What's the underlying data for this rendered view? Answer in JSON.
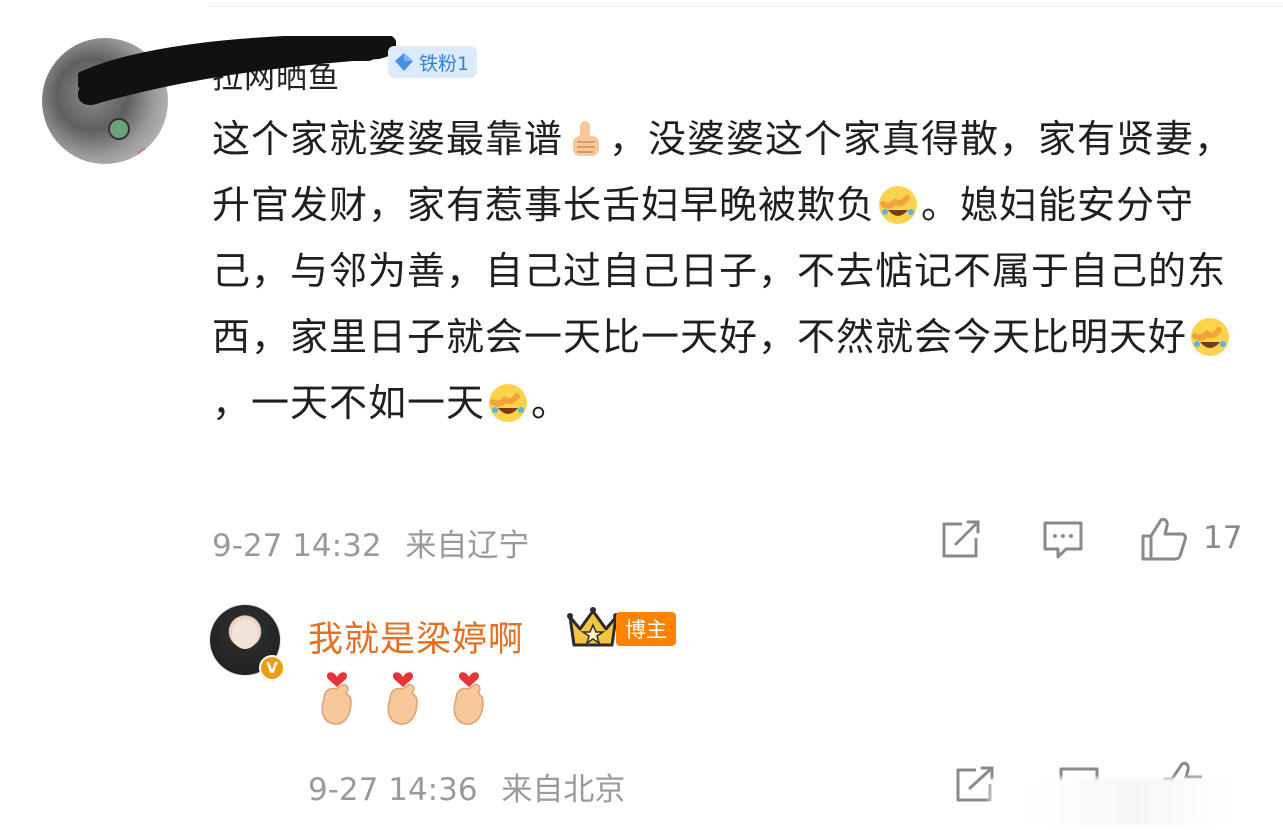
{
  "comment": {
    "username": "拉网晒鱼",
    "fan_badge": "铁粉1",
    "text": {
      "part1": "这个家就婆婆最靠谱",
      "part2": "，没婆婆这个家真得散，家有贤妻，升官发财，家有惹事长舌妇早晚被欺负",
      "part3": "。媳妇能安分守己，与邻为善，自己过自己日子，不去惦记不属于自己的东西，家里日子就会一天比一天好，不然就会今天比明天好",
      "part4": "，一天不如一天",
      "part5": "。"
    },
    "date": "9-27 14:32",
    "location": "来自辽宁",
    "like_count": "17"
  },
  "reply": {
    "username": "我就是梁婷啊",
    "badge": "博主",
    "verified_mark": "V",
    "date": "9-27 14:36",
    "location": "来自北京"
  },
  "colors": {
    "reply_username": "#e56e1f",
    "blogger_badge": "#ff8200",
    "fan_badge_bg": "#dcebfb",
    "fan_badge_text": "#3a7fd8",
    "meta_text": "#9a9a9a"
  },
  "icons": [
    "thumbs-up-emoji",
    "facepalm-laughing-emoji",
    "share-icon",
    "comment-icon",
    "like-icon",
    "crown-icon",
    "finger-heart-emoji"
  ]
}
